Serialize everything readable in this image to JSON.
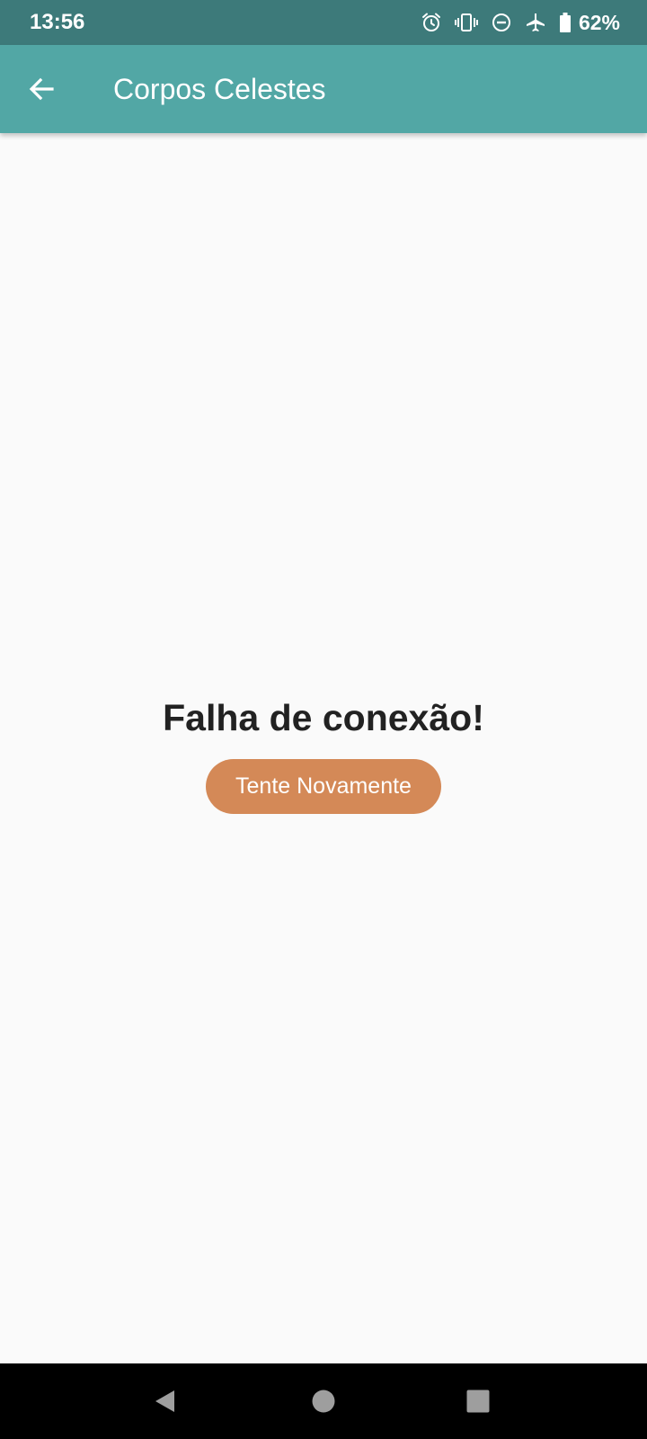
{
  "status_bar": {
    "time": "13:56",
    "icons": [
      "alarm-icon",
      "vibrate-icon",
      "do-not-disturb-icon",
      "airplane-mode-icon",
      "battery-icon"
    ],
    "battery_percent": "62%"
  },
  "app_bar": {
    "back_icon": "arrow-back-icon",
    "title": "Corpos Celestes"
  },
  "main": {
    "error_message": "Falha de conexão!",
    "retry_button_label": "Tente Novamente"
  },
  "nav_bar": {
    "buttons": [
      "nav-back-icon",
      "nav-home-icon",
      "nav-recents-icon"
    ]
  },
  "colors": {
    "status_bar": "#3d7a7a",
    "app_bar": "#52a7a5",
    "background": "#fafafa",
    "retry_button": "#d48957",
    "error_text": "#222222"
  }
}
